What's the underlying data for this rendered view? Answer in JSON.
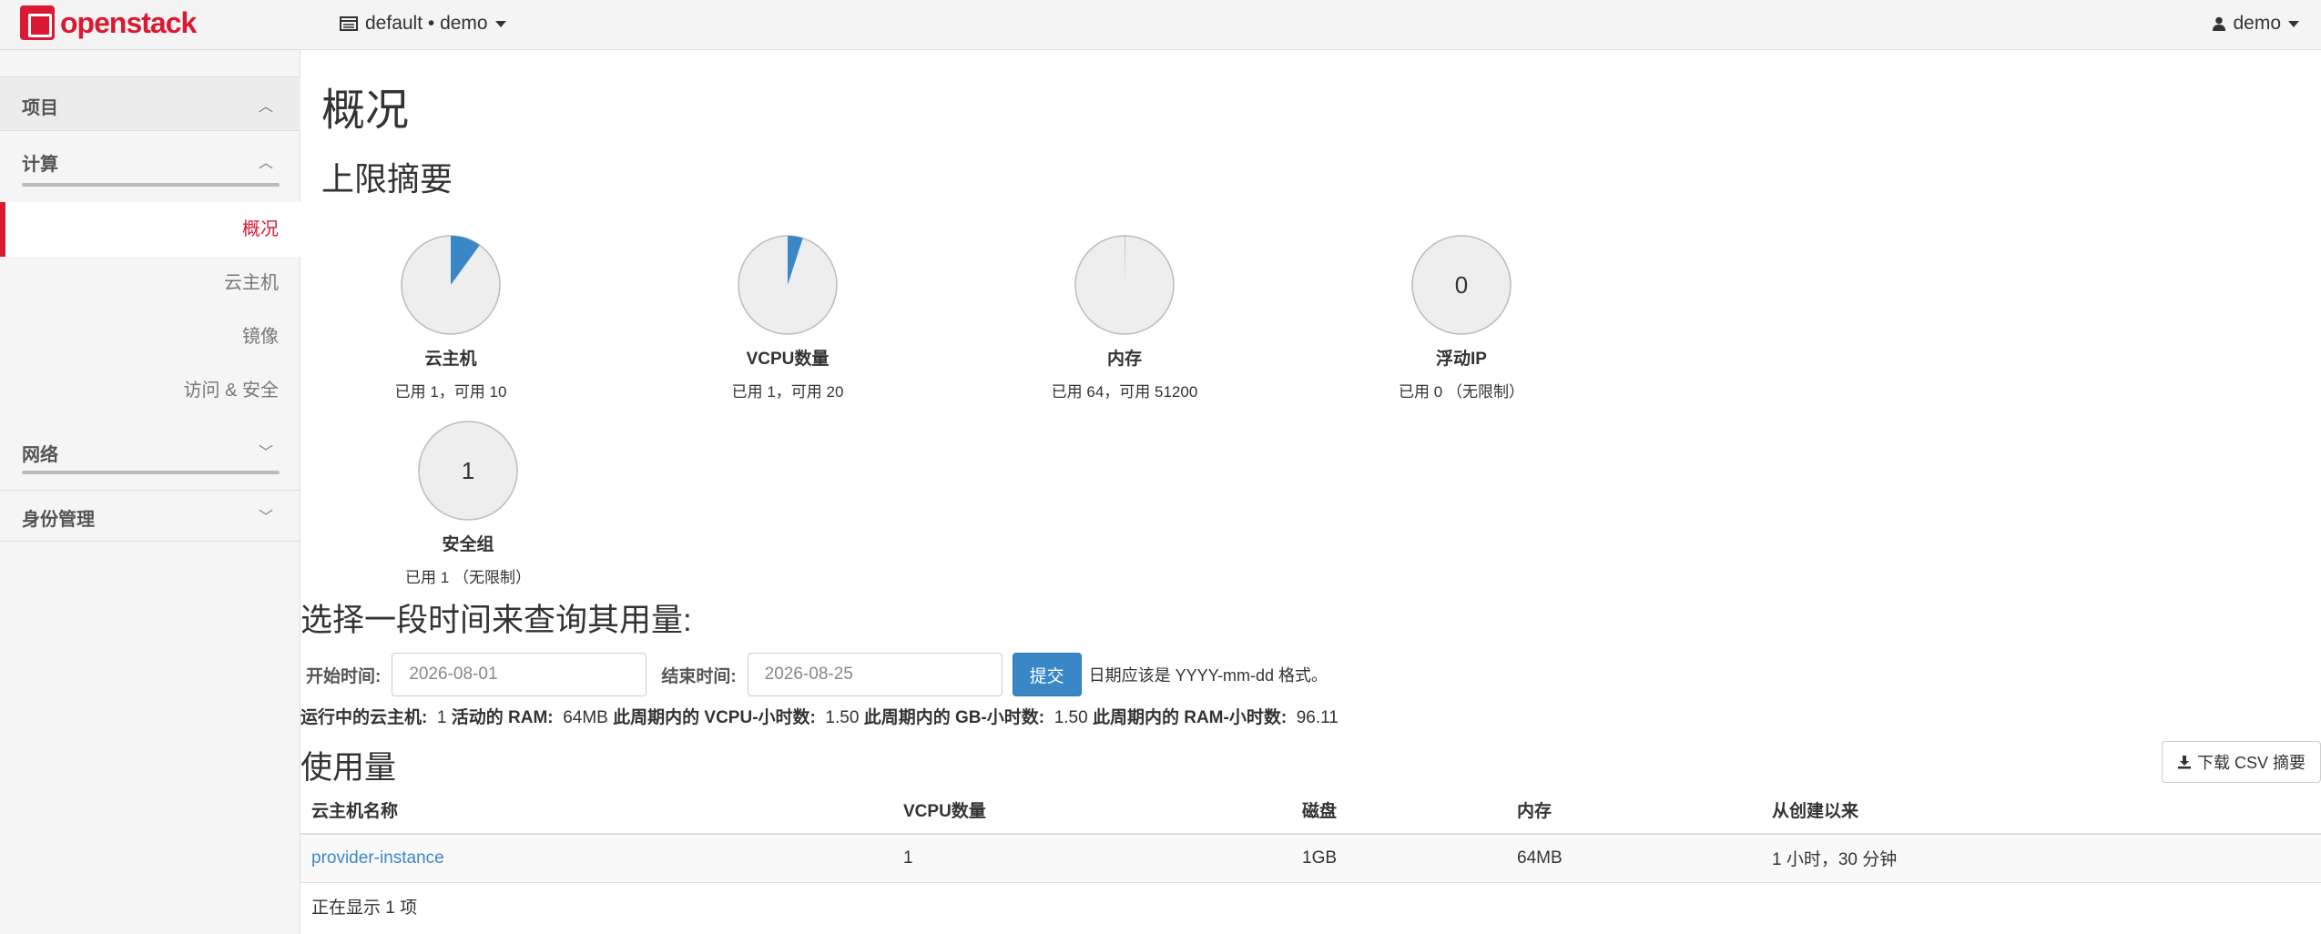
{
  "topbar": {
    "brand": "openstack",
    "project_selector": "default • demo",
    "user_menu": "demo"
  },
  "sidebar": {
    "section_project": "项目",
    "section_compute": "计算",
    "items": [
      {
        "label": "概况",
        "active": true
      },
      {
        "label": "云主机"
      },
      {
        "label": "镜像"
      },
      {
        "label": "访问 & 安全"
      }
    ],
    "section_network": "网络",
    "section_identity": "身份管理"
  },
  "main": {
    "title": "概况",
    "limits_title": "上限摘要",
    "pies": [
      {
        "label": "云主机",
        "sub": "已用 1，可用 10",
        "used": 1,
        "total": 10,
        "center_text": ""
      },
      {
        "label": "VCPU数量",
        "sub": "已用 1，可用 20",
        "used": 1,
        "total": 20,
        "center_text": ""
      },
      {
        "label": "内存",
        "sub": "已用 64，可用 51200",
        "used": 64,
        "total": 51200,
        "center_text": ""
      },
      {
        "label": "浮动IP",
        "sub": "已用 0 （无限制）",
        "used": 0,
        "total": 0,
        "center_text": "0"
      },
      {
        "label": "安全组",
        "sub": "已用 1 （无限制）",
        "used": 1,
        "total": 0,
        "center_text": "1"
      }
    ],
    "query_title": "选择一段时间来查询其用量:",
    "start_label": "开始时间:",
    "start_value": "2026-08-01",
    "end_label": "结束时间:",
    "end_value": "2026-08-25",
    "submit_label": "提交",
    "date_hint": "日期应该是 YYYY-mm-dd 格式。",
    "stats": {
      "running_label": "运行中的云主机:",
      "running_value": "1",
      "ram_label": "活动的 RAM:",
      "ram_value": "64MB",
      "vcpu_hours_label": "此周期内的 VCPU-小时数:",
      "vcpu_hours_value": "1.50",
      "gb_hours_label": "此周期内的 GB-小时数:",
      "gb_hours_value": "1.50",
      "ram_hours_label": "此周期内的 RAM-小时数:",
      "ram_hours_value": "96.11"
    },
    "usage_title": "使用量",
    "csv_button": "下载 CSV 摘要",
    "table": {
      "headers": [
        "云主机名称",
        "VCPU数量",
        "磁盘",
        "内存",
        "从创建以来"
      ],
      "rows": [
        [
          "provider-instance",
          "1",
          "1GB",
          "64MB",
          "1 小时，30 分钟"
        ]
      ],
      "footer": "正在显示 1 项"
    }
  },
  "colors": {
    "brand_red": "#da1a32",
    "pie_fill": "#3a87c8",
    "pie_bg": "#eeeeee",
    "link": "#3a87c8"
  }
}
